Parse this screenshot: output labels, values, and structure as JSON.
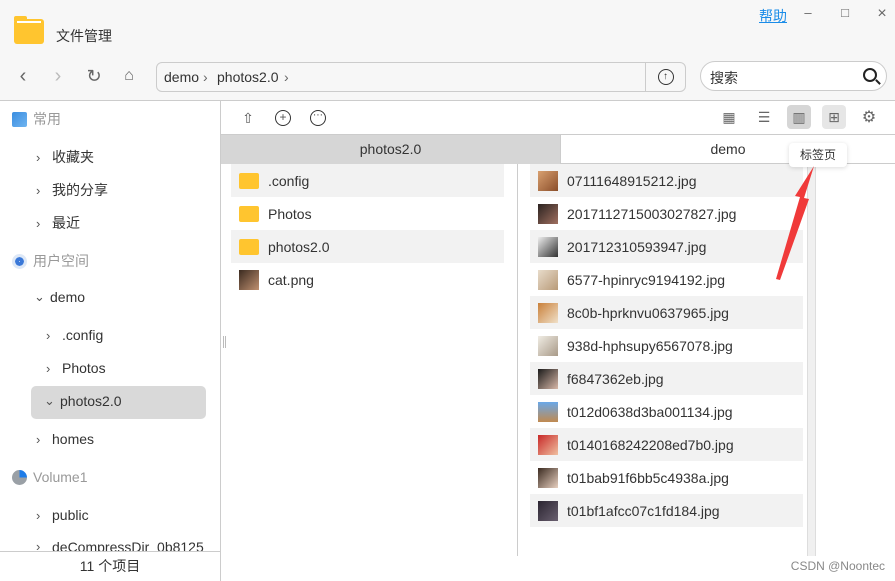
{
  "app": {
    "title": "文件管理",
    "help": "帮助"
  },
  "window": {
    "minimize": "–",
    "maximize": "□",
    "close": "×"
  },
  "breadcrumb": [
    "demo",
    "photos2.0"
  ],
  "search": {
    "placeholder": "搜索"
  },
  "sidebar": {
    "common": "常用",
    "favorites": "收藏夹",
    "shares": "我的分享",
    "recent": "最近",
    "user_space": "用户空间",
    "demo": "demo",
    "config": ".config",
    "photos": "Photos",
    "photos2": "photos2.0",
    "homes": "homes",
    "volume": "Volume1",
    "public": "public",
    "decompress": "deCompressDir_0b8125",
    "footer": "11 个项目"
  },
  "tabs": [
    "photos2.0",
    "demo"
  ],
  "tooltip": "标签页",
  "column1": [
    {
      "name": ".config",
      "type": "folder"
    },
    {
      "name": "Photos",
      "type": "folder"
    },
    {
      "name": "photos2.0",
      "type": "folder"
    },
    {
      "name": "cat.png",
      "type": "image"
    }
  ],
  "files": [
    "07111648915212.jpg",
    "2017112715003027827.jpg",
    "201712310593947.jpg",
    "6577-hpinryc9194192.jpg",
    "8c0b-hprknvu0637965.jpg",
    "938d-hphsupy6567078.jpg",
    "f6847362eb.jpg",
    "t012d0638d3ba001134.jpg",
    "t0140168242208ed7b0.jpg",
    "t01bab91f6bb5c4938a.jpg",
    "t01bf1afcc07c1fd184.jpg"
  ],
  "watermark": "CSDN @Noontec",
  "colors": {
    "accent": "#1a8ce8",
    "folder": "#ffc52f",
    "arrow": "#f03a3a"
  }
}
